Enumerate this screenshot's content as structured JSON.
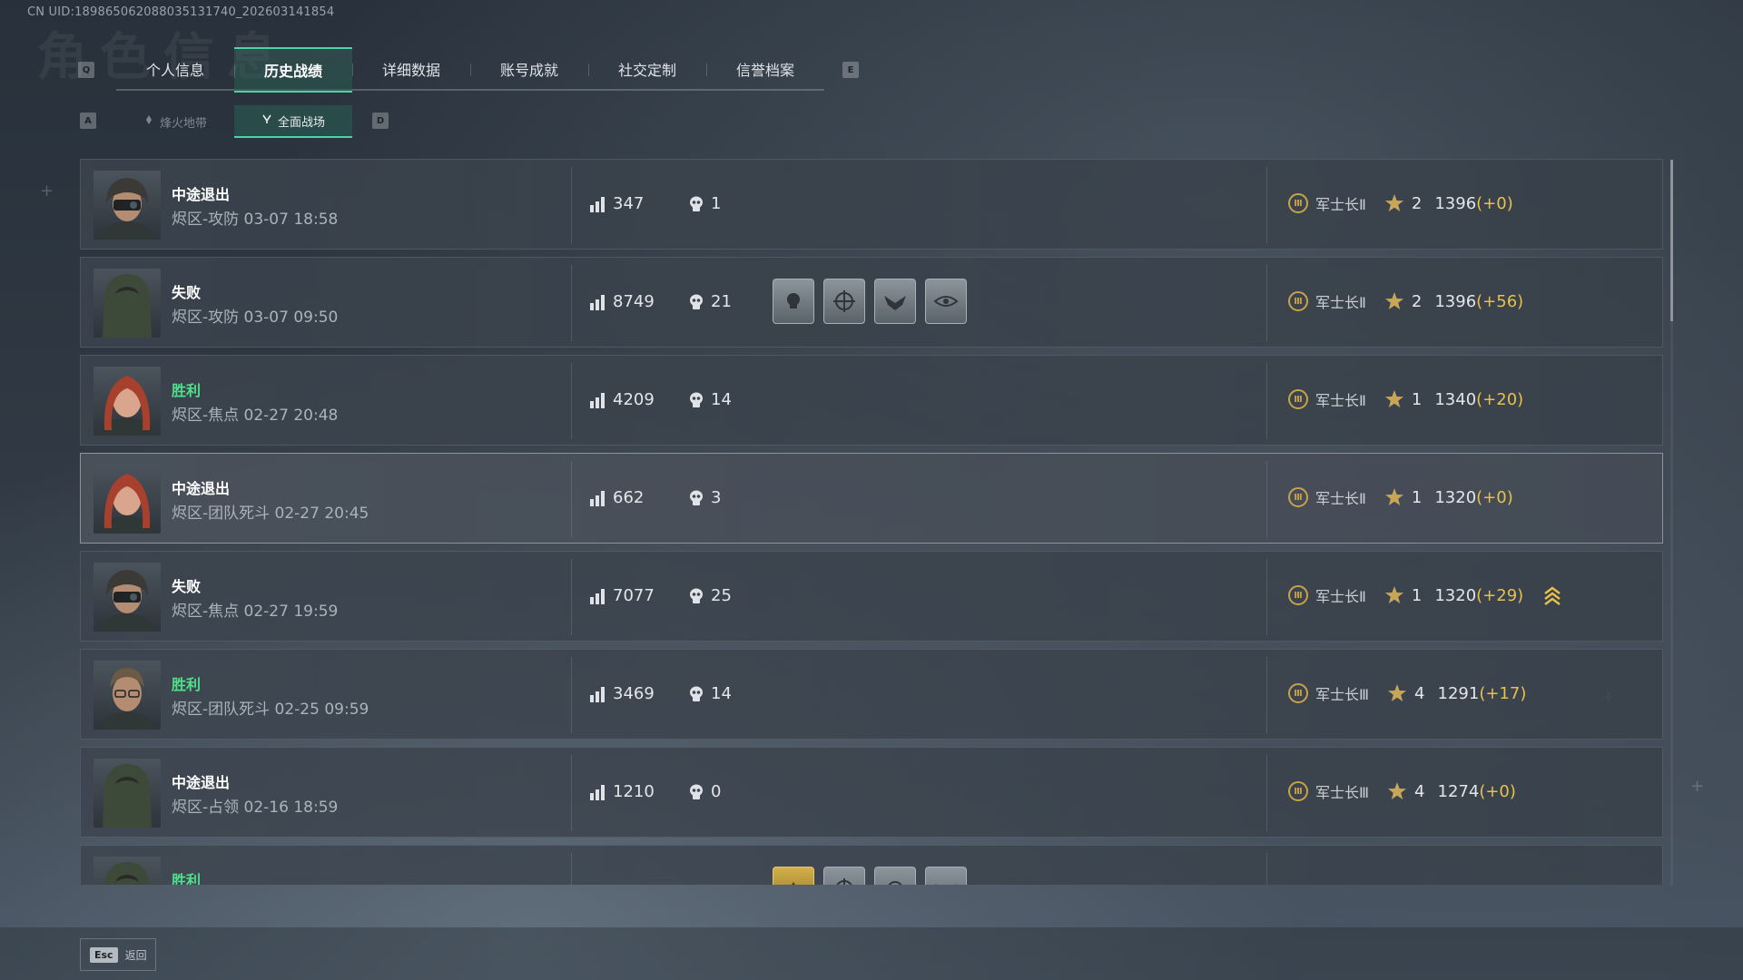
{
  "uid": "CN UID:189865062088035131740_202603141854",
  "ghost_title": "角色信息",
  "keys": {
    "prev_tab": "Q",
    "next_tab": "E",
    "prev_sub": "A",
    "next_sub": "D"
  },
  "tabs": [
    {
      "label": "个人信息",
      "active": false
    },
    {
      "label": "历史战绩",
      "active": true
    },
    {
      "label": "详细数据",
      "active": false
    },
    {
      "label": "账号成就",
      "active": false
    },
    {
      "label": "社交定制",
      "active": false
    },
    {
      "label": "信誉档案",
      "active": false
    }
  ],
  "subtabs": [
    {
      "label": "烽火地带",
      "icon": "fire-zone-icon",
      "active": false
    },
    {
      "label": "全面战场",
      "icon": "battlefield-icon",
      "active": true
    }
  ],
  "matches": [
    {
      "result": "中途退出",
      "win": false,
      "mode": "烬区-攻防 03-07 18:58",
      "score": "347",
      "kills": "1",
      "medals": [],
      "rank": "军士长Ⅱ",
      "stars": "2",
      "elo": "1396",
      "delta": "(+0)",
      "highlight": false,
      "chevron": false,
      "avatar": "masked"
    },
    {
      "result": "失败",
      "win": false,
      "mode": "烬区-攻防 03-07 09:50",
      "score": "8749",
      "kills": "21",
      "medals": [
        "skull-medal-icon",
        "crosshair-medal-icon",
        "eagle-medal-icon",
        "eye-medal-icon"
      ],
      "rank": "军士长Ⅱ",
      "stars": "2",
      "elo": "1396",
      "delta": "(+56)",
      "highlight": false,
      "chevron": false,
      "avatar": "hood"
    },
    {
      "result": "胜利",
      "win": true,
      "mode": "烬区-焦点 02-27 20:48",
      "score": "4209",
      "kills": "14",
      "medals": [],
      "rank": "军士长Ⅱ",
      "stars": "1",
      "elo": "1340",
      "delta": "(+20)",
      "highlight": false,
      "chevron": false,
      "avatar": "redhair"
    },
    {
      "result": "中途退出",
      "win": false,
      "mode": "烬区-团队死斗 02-27 20:45",
      "score": "662",
      "kills": "3",
      "medals": [],
      "rank": "军士长Ⅱ",
      "stars": "1",
      "elo": "1320",
      "delta": "(+0)",
      "highlight": true,
      "chevron": false,
      "avatar": "redhair"
    },
    {
      "result": "失败",
      "win": false,
      "mode": "烬区-焦点 02-27 19:59",
      "score": "7077",
      "kills": "25",
      "medals": [],
      "rank": "军士长Ⅱ",
      "stars": "1",
      "elo": "1320",
      "delta": "(+29)",
      "highlight": false,
      "chevron": true,
      "avatar": "masked"
    },
    {
      "result": "胜利",
      "win": true,
      "mode": "烬区-团队死斗 02-25 09:59",
      "score": "3469",
      "kills": "14",
      "medals": [],
      "rank": "军士长Ⅲ",
      "stars": "4",
      "elo": "1291",
      "delta": "(+17)",
      "highlight": false,
      "chevron": false,
      "avatar": "glasses"
    },
    {
      "result": "中途退出",
      "win": false,
      "mode": "烬区-占领 02-16 18:59",
      "score": "1210",
      "kills": "0",
      "medals": [],
      "rank": "军士长Ⅲ",
      "stars": "4",
      "elo": "1274",
      "delta": "(+0)",
      "highlight": false,
      "chevron": false,
      "avatar": "hood"
    },
    {
      "result": "胜利",
      "win": true,
      "mode": "",
      "score": "",
      "kills": "",
      "medals": [
        "gold-medal-icon",
        "crosshair-medal-icon",
        "target-medal-icon",
        "eagle-medal-icon"
      ],
      "rank": "",
      "stars": "",
      "elo": "",
      "delta": "",
      "highlight": false,
      "chevron": false,
      "avatar": "hood"
    }
  ],
  "footer": {
    "esc_key": "Esc",
    "back_label": "返回"
  },
  "colors": {
    "accent": "#4fd1a5",
    "win": "#4ee08a",
    "delta": "#e8c04a",
    "rank_gold": "#c9a14a"
  }
}
